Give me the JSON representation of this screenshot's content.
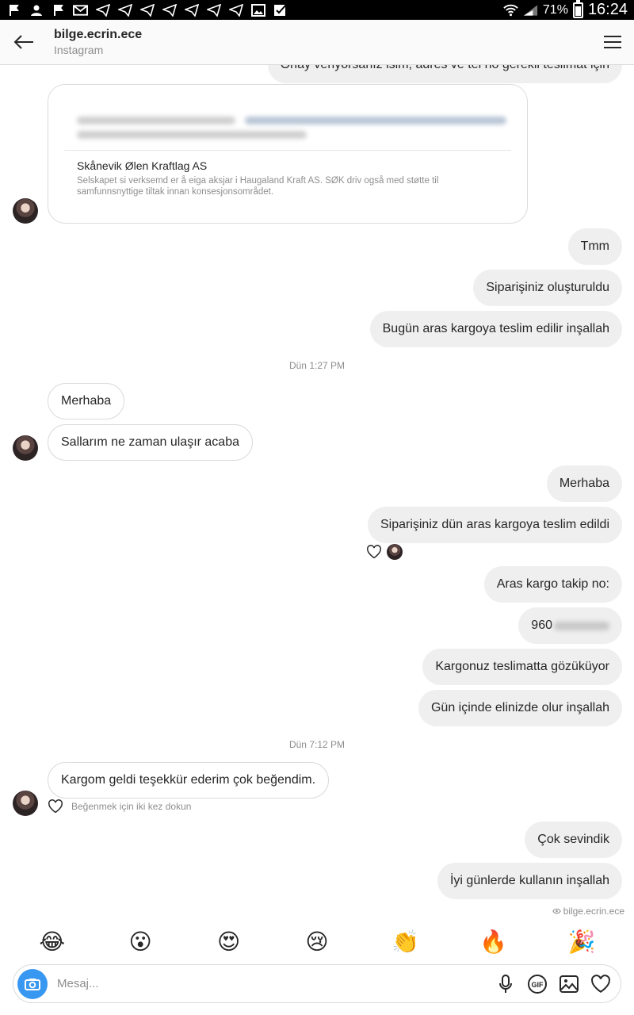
{
  "status_bar": {
    "battery": "71%",
    "time": "16:24"
  },
  "header": {
    "username": "bilge.ecrin.ece",
    "subtitle": "Instagram"
  },
  "chat": {
    "truncated_top": "Onay veriyorsanız isim, adres ve tel no gerekli teslimat için",
    "link_card": {
      "title": "Skånevik Ølen Kraftlag AS",
      "description": "Selskapet si verksemd er å eiga aksjar i Haugaland Kraft AS. SØK driv også med støtte til samfunnsnyttige tiltak innan konsesjonsområdet."
    },
    "msg_tmm": "Tmm",
    "msg_order_created": "Siparişiniz oluşturuldu",
    "msg_today_delivery": "Bugün aras kargoya teslim edilir inşallah",
    "ts_1": "Dün 1:27 PM",
    "msg_in_hello": "Merhaba",
    "msg_in_when": "Sallarım ne zaman ulaşır acaba",
    "msg_out_hello": "Merhaba",
    "msg_delivered_yesterday": "Siparişiniz dün aras kargoya teslim edildi",
    "msg_tracking_label": "Aras kargo takip no:",
    "msg_tracking_prefix": "960",
    "msg_in_delivery": "Kargonuz teslimatta gözüküyor",
    "msg_today_hand": "Gün içinde elinizde olur inşallah",
    "ts_2": "Dün 7:12 PM",
    "msg_in_thanks": "Kargom geldi teşekkür ederim çok beğendim.",
    "like_hint": "Beğenmek için iki kez dokun",
    "msg_glad": "Çok sevindik",
    "msg_good_days": "İyi günlerde kullanın inşallah",
    "seen_by": "bilge.ecrin.ece"
  },
  "emoji_bar": [
    "😂",
    "😮",
    "😍",
    "😢",
    "👏",
    "🔥",
    "🎉"
  ],
  "composer": {
    "placeholder": "Mesaj..."
  }
}
